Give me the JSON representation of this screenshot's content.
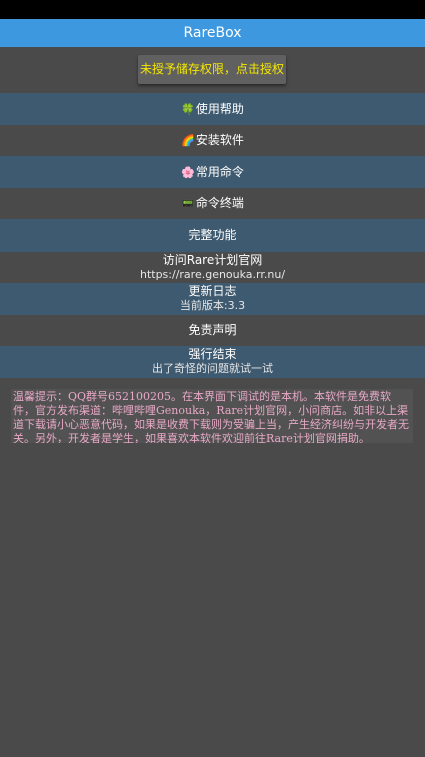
{
  "app": {
    "title": "RareBox"
  },
  "permission_button": {
    "label": "未授予储存权限，点击授权",
    "color": "#f5e800"
  },
  "menu": {
    "help": {
      "icon": "🍀",
      "label": "使用帮助"
    },
    "install": {
      "icon": "🌈",
      "label": "安装软件"
    },
    "commands": {
      "icon": "🌸",
      "label": "常用命令"
    },
    "terminal": {
      "icon": "📟",
      "label": "命令终端"
    },
    "full": {
      "label": "完整功能"
    },
    "website": {
      "label": "访问Rare计划官网",
      "sub": "https://rare.genouka.rr.nu/"
    },
    "changelog": {
      "label": "更新日志",
      "sub": "当前版本:3.3"
    },
    "disclaimer": {
      "label": "免责声明"
    },
    "force_stop": {
      "label": "强行结束",
      "sub": "出了奇怪的问题就试一试"
    }
  },
  "notice": {
    "text": "温馨提示：QQ群号652100205。在本界面下调试的是本机。本软件是免费软件，官方发布渠道：哔哩哔哩Genouka，Rare计划官网，小问商店。如非以上渠道下载请小心恶意代码，如果是收费下载则为受骗上当，产生经济纠纷与开发者无关。另外，开发者是学生，如果喜欢本软件欢迎前往Rare计划官网捐助。"
  },
  "colors": {
    "titlebar": "#3d98e0",
    "row_blue": "#3e5a70",
    "background": "#4a4a4a",
    "notice_text": "#e9a9c6"
  }
}
